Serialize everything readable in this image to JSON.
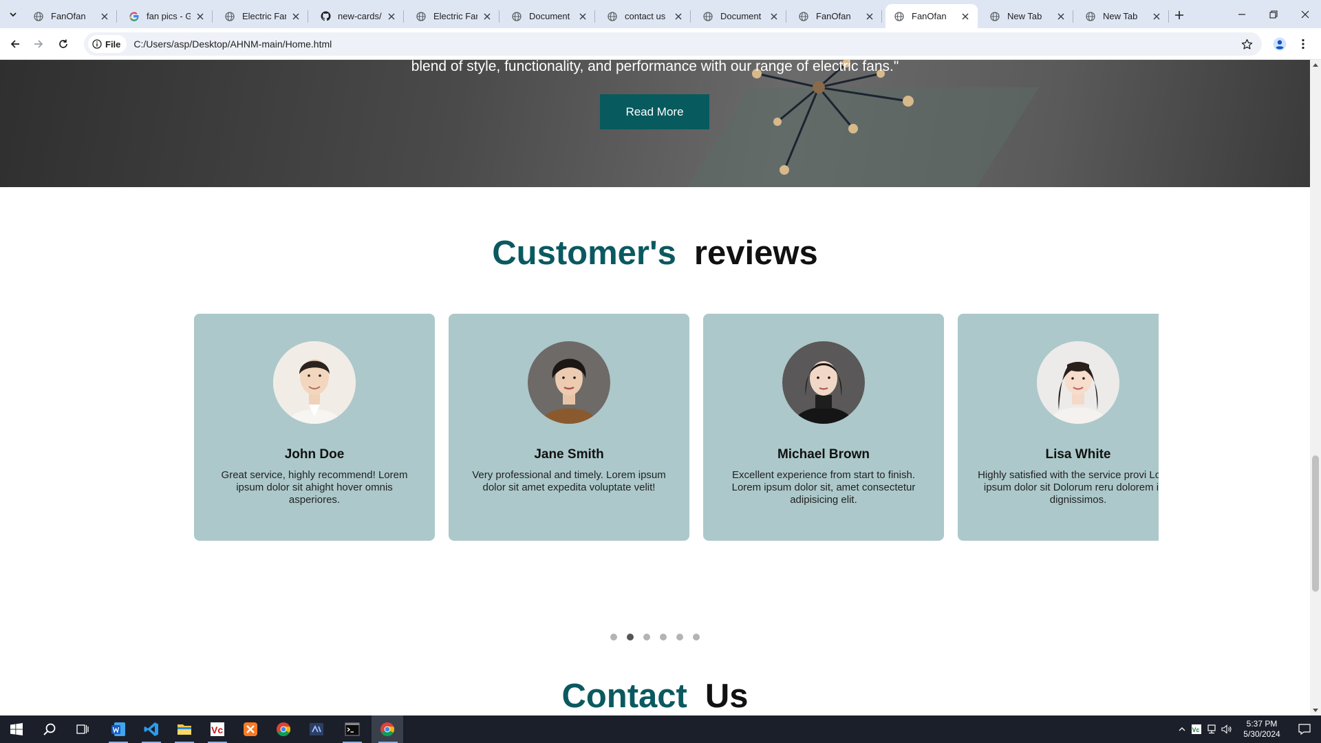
{
  "browser": {
    "tabs": [
      {
        "title": "FanOfan",
        "icon": "globe-icon",
        "active": false
      },
      {
        "title": "fan pics - Go",
        "icon": "google-icon",
        "active": false
      },
      {
        "title": "Electric Fan C",
        "icon": "globe-icon",
        "active": false
      },
      {
        "title": "new-cards/c",
        "icon": "github-icon",
        "active": false
      },
      {
        "title": "Electric Fan C",
        "icon": "globe-icon",
        "active": false
      },
      {
        "title": "Document",
        "icon": "globe-icon",
        "active": false
      },
      {
        "title": "contact us",
        "icon": "globe-icon",
        "active": false
      },
      {
        "title": "Document",
        "icon": "globe-icon",
        "active": false
      },
      {
        "title": "FanOfan",
        "icon": "globe-icon",
        "active": false
      },
      {
        "title": "FanOfan",
        "icon": "globe-icon",
        "active": true
      },
      {
        "title": "New Tab",
        "icon": "chrome-icon",
        "active": false
      },
      {
        "title": "New Tab",
        "icon": "chrome-icon",
        "active": false
      }
    ],
    "address": {
      "chip_label": "File",
      "url": "C:/Users/asp/Desktop/AHNM-main/Home.html"
    }
  },
  "page": {
    "hero": {
      "text": "blend of style, functionality, and performance with our range of electric fans.\"",
      "button_label": "Read More"
    },
    "reviews": {
      "title_accent": "Customer's",
      "title_rest": "reviews",
      "cards": [
        {
          "name": "John Doe",
          "text": "Great service, highly recommend! Lorem ipsum dolor sit ahight hover omnis asperiores."
        },
        {
          "name": "Jane Smith",
          "text": "Very professional and timely. Lorem ipsum dolor sit amet expedita voluptate velit!"
        },
        {
          "name": "Michael Brown",
          "text": "Excellent experience from start to finish. Lorem ipsum dolor sit, amet consectetur adipisicing elit."
        },
        {
          "name": "Lisa White",
          "text": "Highly satisfied with the service provi Lorem ipsum dolor sit Dolorum reru dolorem iste dignissimos."
        }
      ],
      "dots_count": 6,
      "active_dot": 2
    },
    "contact": {
      "title_accent": "Contact",
      "title_rest": "Us"
    }
  },
  "taskbar": {
    "apps": [
      "start-icon",
      "search-icon",
      "task-view-icon",
      "word-icon",
      "vscode-icon",
      "file-explorer-icon",
      "vc-app-icon",
      "xampp-icon",
      "chrome-icon",
      "visual-studio-icon",
      "terminal-icon",
      "chrome-profile-icon"
    ],
    "clock_time": "5:37 PM",
    "clock_date": "5/30/2024"
  },
  "colors": {
    "accent": "#0b5960",
    "card_bg": "#acc8ca",
    "button_bg": "#075a5e"
  }
}
